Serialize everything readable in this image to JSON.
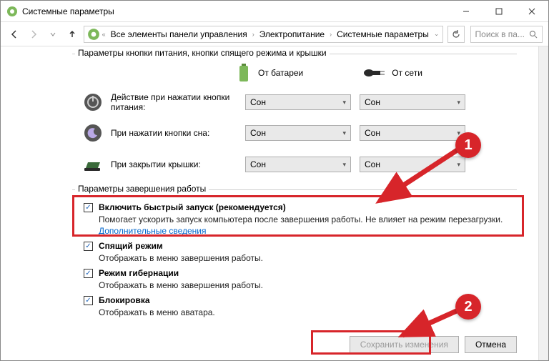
{
  "window": {
    "title": "Системные параметры"
  },
  "breadcrumb": {
    "item1": "Все элементы панели управления",
    "item2": "Электропитание",
    "item3": "Системные параметры"
  },
  "search": {
    "placeholder": "Поиск в па..."
  },
  "fieldset1": {
    "legend": "Параметры кнопки питания, кнопки спящего режима и крышки",
    "col_battery": "От батареи",
    "col_ac": "От сети",
    "row1_label": "Действие при нажатии кнопки питания:",
    "row2_label": "При нажатии кнопки сна:",
    "row3_label": "При закрытии крышки:",
    "value": "Сон"
  },
  "fieldset2": {
    "legend": "Параметры завершения работы",
    "cb1_label": "Включить быстрый запуск (рекомендуется)",
    "cb1_desc1": "Помогает ускорить запуск компьютера после завершения работы. Не влияет на режим перезагрузки. ",
    "cb1_link": "Дополнительные сведения",
    "cb2_label": "Спящий режим",
    "cb2_desc": "Отображать в меню завершения работы.",
    "cb3_label": "Режим гибернации",
    "cb3_desc": "Отображать в меню завершения работы.",
    "cb4_label": "Блокировка",
    "cb4_desc": "Отображать в меню аватара."
  },
  "buttons": {
    "save": "Сохранить изменения",
    "cancel": "Отмена"
  },
  "annotations": {
    "step1": "1",
    "step2": "2"
  }
}
